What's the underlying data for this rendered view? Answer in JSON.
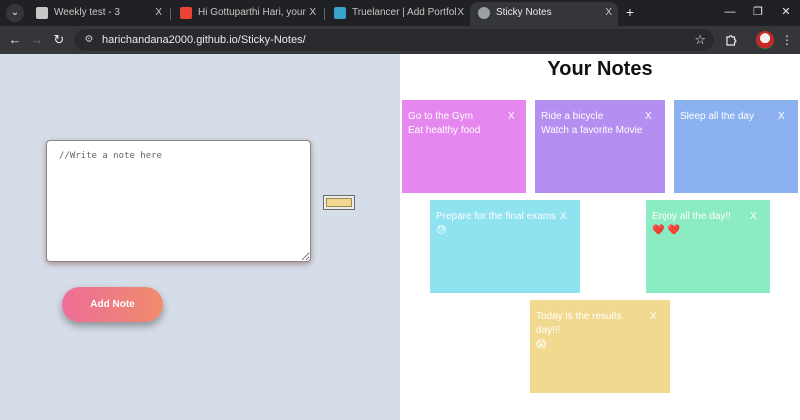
{
  "browser": {
    "tab_menu_icon": "chevron-down-icon",
    "tabs": [
      {
        "title": "Weekly test - 3",
        "favicon_color": "#c4c7c5",
        "active": false
      },
      {
        "title": "Hi Gottuparthi Hari, your Truela",
        "favicon_color": "#ea4335",
        "active": false
      },
      {
        "title": "Truelancer | Add Portfolio",
        "favicon_color": "#3aa3c9",
        "active": false
      },
      {
        "title": "Sticky Notes",
        "favicon_color": "#9aa0a6",
        "active": true
      }
    ],
    "tab_close": "X",
    "new_tab": "+",
    "window_controls": {
      "minimize": "—",
      "restore": "❐",
      "close": "✕"
    },
    "nav": {
      "back": "←",
      "forward": "→",
      "reload": "↻"
    },
    "url": "harichandana2000.github.io/Sticky-Notes/",
    "bookmark_star": "☆",
    "extensions_icon": "puzzle-icon",
    "menu_dots": "⋮"
  },
  "composer": {
    "placeholder": "//Write a note here",
    "color_value": "#f1da8f",
    "add_button_label": "Add Note"
  },
  "notes_section": {
    "title": "Your Notes",
    "close_label": "X",
    "notes": [
      {
        "line1": "Go to the Gym",
        "line2": "Eat healthy food",
        "color": "#e687ef"
      },
      {
        "line1": "Ride a bicycle",
        "line2": "Watch a favorite Movie",
        "color": "#b48ff0"
      },
      {
        "line1": "Sleep all the day",
        "line2": "",
        "color": "#8cb1f1"
      },
      {
        "line1": "Prepare for the final exams",
        "line2": "😓",
        "color": "#8fe2ef"
      },
      {
        "line1": "Enjoy all the day!!",
        "line2": "❤️ ❤️",
        "color": "#8bebc2"
      },
      {
        "line1": "Today is the results day!!!",
        "line2": "😱",
        "color": "#f1da8f"
      }
    ]
  }
}
